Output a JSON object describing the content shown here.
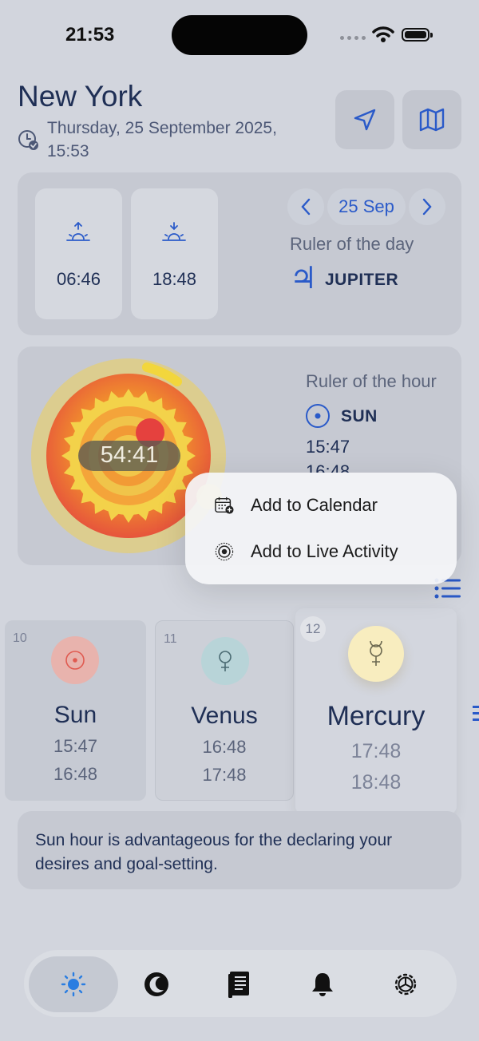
{
  "status_bar": {
    "time": "21:53"
  },
  "header": {
    "city": "New York",
    "datetime": "Thursday, 25 September 2025, 15:53"
  },
  "day_panel": {
    "sunrise": "06:46",
    "sunset": "18:48",
    "date": "25 Sep",
    "ruler_label": "Ruler of the day",
    "ruler_symbol": "♃",
    "ruler_name": "JUPITER"
  },
  "hour_panel": {
    "countdown": "54:41",
    "progress": 0.1,
    "ruler_label": "Ruler of the hour",
    "ruler_name": "SUN",
    "start": "15:47",
    "end_partial": "16:48"
  },
  "menu": {
    "items": [
      {
        "label": "Add to Calendar",
        "icon": "calendar-add-icon"
      },
      {
        "label": "Add to Live Activity",
        "icon": "live-activity-icon"
      }
    ]
  },
  "hours": [
    {
      "num": "10",
      "name": "Sun",
      "symbol": "☉",
      "start": "15:47",
      "end": "16:48",
      "color": "#eab3ae"
    },
    {
      "num": "11",
      "name": "Venus",
      "symbol": "♀",
      "start": "16:48",
      "end": "17:48",
      "color": "#b9d6d9"
    },
    {
      "num": "12",
      "name": "Mercury",
      "symbol": "☿",
      "start": "17:48",
      "end": "18:48",
      "color": "#f8edbf"
    }
  ],
  "info": {
    "text": "Sun hour is advantageous for the declaring your desires and goal-setting."
  },
  "tabs": [
    "sun-tab",
    "moon-tab",
    "journal-tab",
    "notifications-tab",
    "settings-tab"
  ],
  "colors": {
    "accent": "#2a5ac9",
    "text": "#1f2f55",
    "background": "#d2d5dd"
  }
}
